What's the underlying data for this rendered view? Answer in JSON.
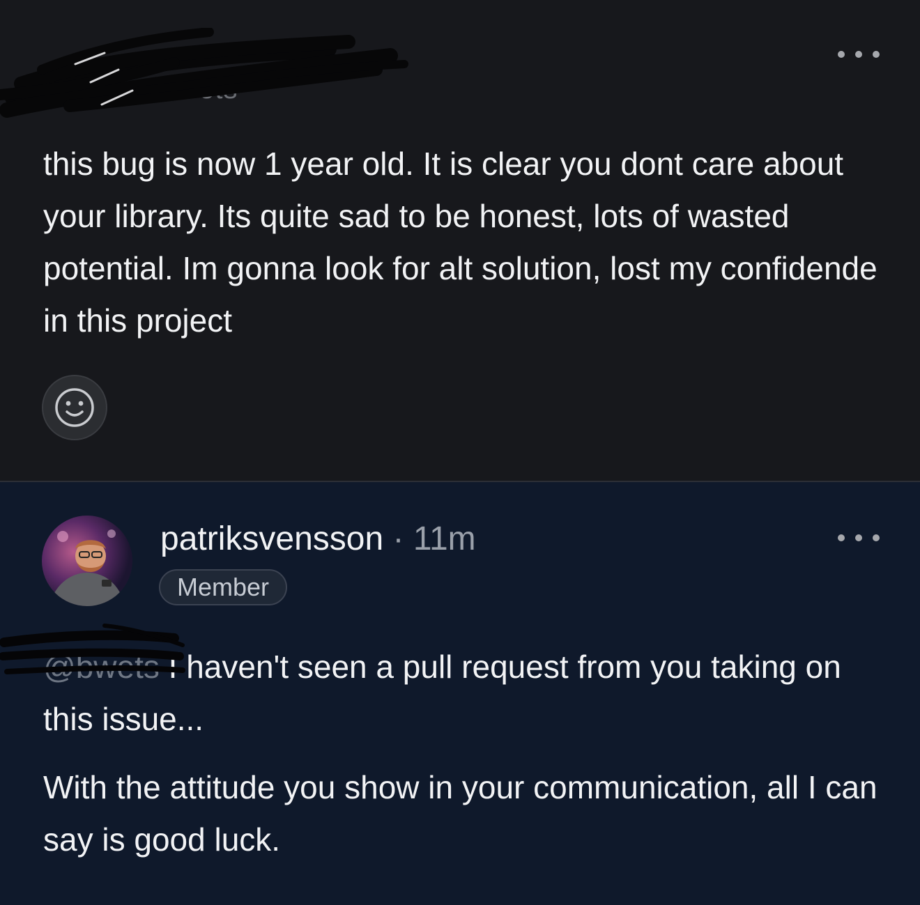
{
  "first_comment": {
    "author_partial": "bwets",
    "body": "this bug is now 1 year old. It is clear you dont care about your library. Its quite sad to be honest, lots of wasted potential. Im gonna look for alt solution, lost my confidende in this project",
    "more_icon": "ellipsis-icon",
    "reaction_icon": "smiley-icon"
  },
  "second_comment": {
    "author": "patriksvensson",
    "separator": "·",
    "time": "11m",
    "badge": "Member",
    "mention": "@bwets",
    "paragraph1_rest": " I haven't seen a pull request from you taking on this issue...",
    "paragraph2": "With the attitude you show in your communication, all I can say is good luck.",
    "more_icon": "ellipsis-icon"
  },
  "colors": {
    "top_bg": "#17181c",
    "bottom_bg": "#0f192b",
    "text": "#f2f3f5",
    "muted": "#9aa0aa"
  }
}
